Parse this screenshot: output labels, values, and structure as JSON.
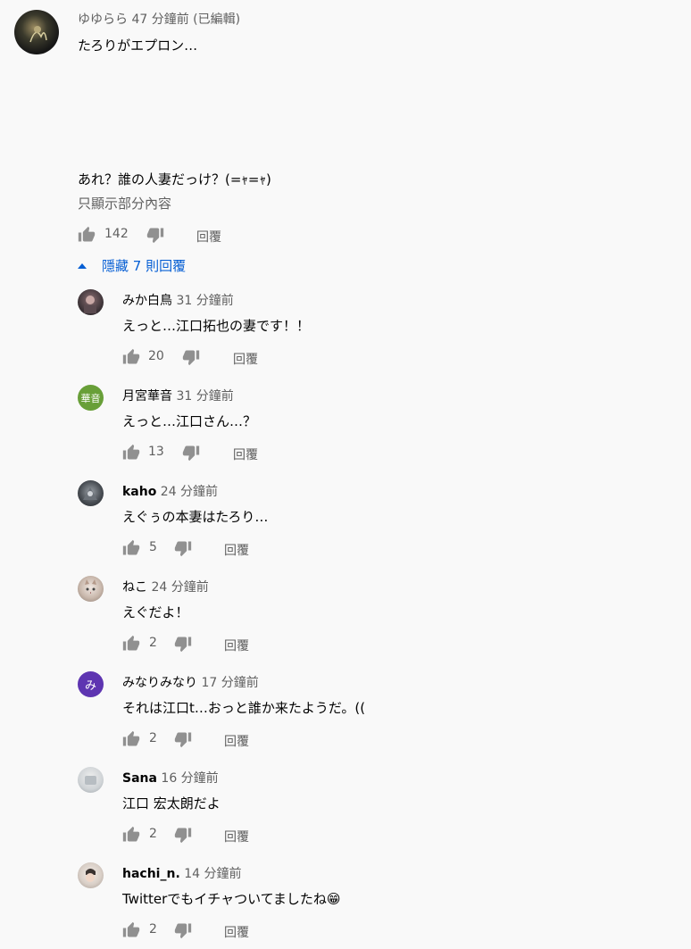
{
  "main_comment": {
    "author": "ゆゆらら",
    "time": "47 分鐘前 (已編輯)",
    "line1": "たろりがエプロン…",
    "line2": "あれ？誰の人妻だっけ？(=ｬ=ｬ)",
    "read_more": "只顯示部分內容",
    "likes": "142",
    "reply_label": "回覆"
  },
  "toggle": {
    "label": "隱藏 7 則回覆"
  },
  "replies": [
    {
      "author": "みか白鳥",
      "time": "31 分鐘前",
      "text": "えっと…江口拓也の妻です！！",
      "likes": "20",
      "reply_label": "回覆"
    },
    {
      "author": "月宮華音",
      "time": "31 分鐘前",
      "text": "えっと…江口さん…？",
      "likes": "13",
      "reply_label": "回覆",
      "avatar_text": "華音"
    },
    {
      "author": "kahо",
      "time": "24 分鐘前",
      "text": "えぐぅの本妻はたろり…",
      "likes": "5",
      "reply_label": "回覆"
    },
    {
      "author": "ねこ",
      "time": "24 分鐘前",
      "text": "えぐだよ！",
      "likes": "2",
      "reply_label": "回覆"
    },
    {
      "author": "みなりみなり",
      "time": "17 分鐘前",
      "text": "それは江口t…おっと誰か来たようだ。((",
      "likes": "2",
      "reply_label": "回覆",
      "avatar_text": "み"
    },
    {
      "author": "Sana",
      "time": "16 分鐘前",
      "text": "江口 宏太朗だよ",
      "likes": "2",
      "reply_label": "回覆"
    },
    {
      "author": "hachi_n.",
      "time": "14 分鐘前",
      "text": "Twitterでもイチャついてましたね😁",
      "likes": "2",
      "reply_label": "回覆"
    }
  ],
  "colors": {
    "background": "#f9f9f9",
    "link": "#065fd4",
    "secondary_text": "#606060",
    "avatar_green": "#689f38",
    "avatar_purple": "#5e35b1"
  },
  "icons": {
    "like": "thumbs-up-icon",
    "dislike": "thumbs-down-icon",
    "toggle": "caret-up-icon"
  }
}
